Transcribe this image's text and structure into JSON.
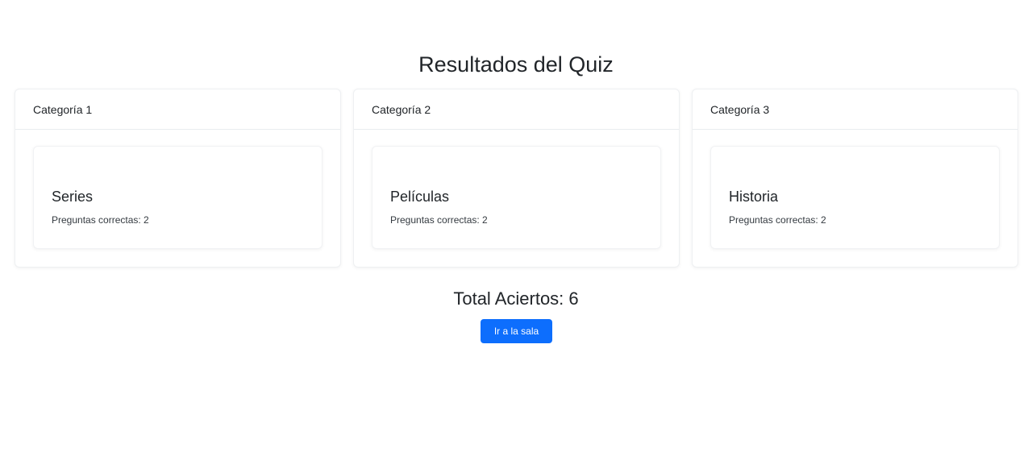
{
  "page": {
    "title": "Resultados del Quiz"
  },
  "categories": [
    {
      "header": "Categoría 1",
      "name": "Series",
      "result": "Preguntas correctas: 2"
    },
    {
      "header": "Categoría 2",
      "name": "Películas",
      "result": "Preguntas correctas: 2"
    },
    {
      "header": "Categoría 3",
      "name": "Historia",
      "result": "Preguntas correctas: 2"
    }
  ],
  "summary": {
    "total_label": "Total Aciertos: 6",
    "button_label": "Ir a la sala"
  },
  "colors": {
    "primary": "#0d6efd",
    "text": "#212529",
    "border": "#e9ecef"
  }
}
